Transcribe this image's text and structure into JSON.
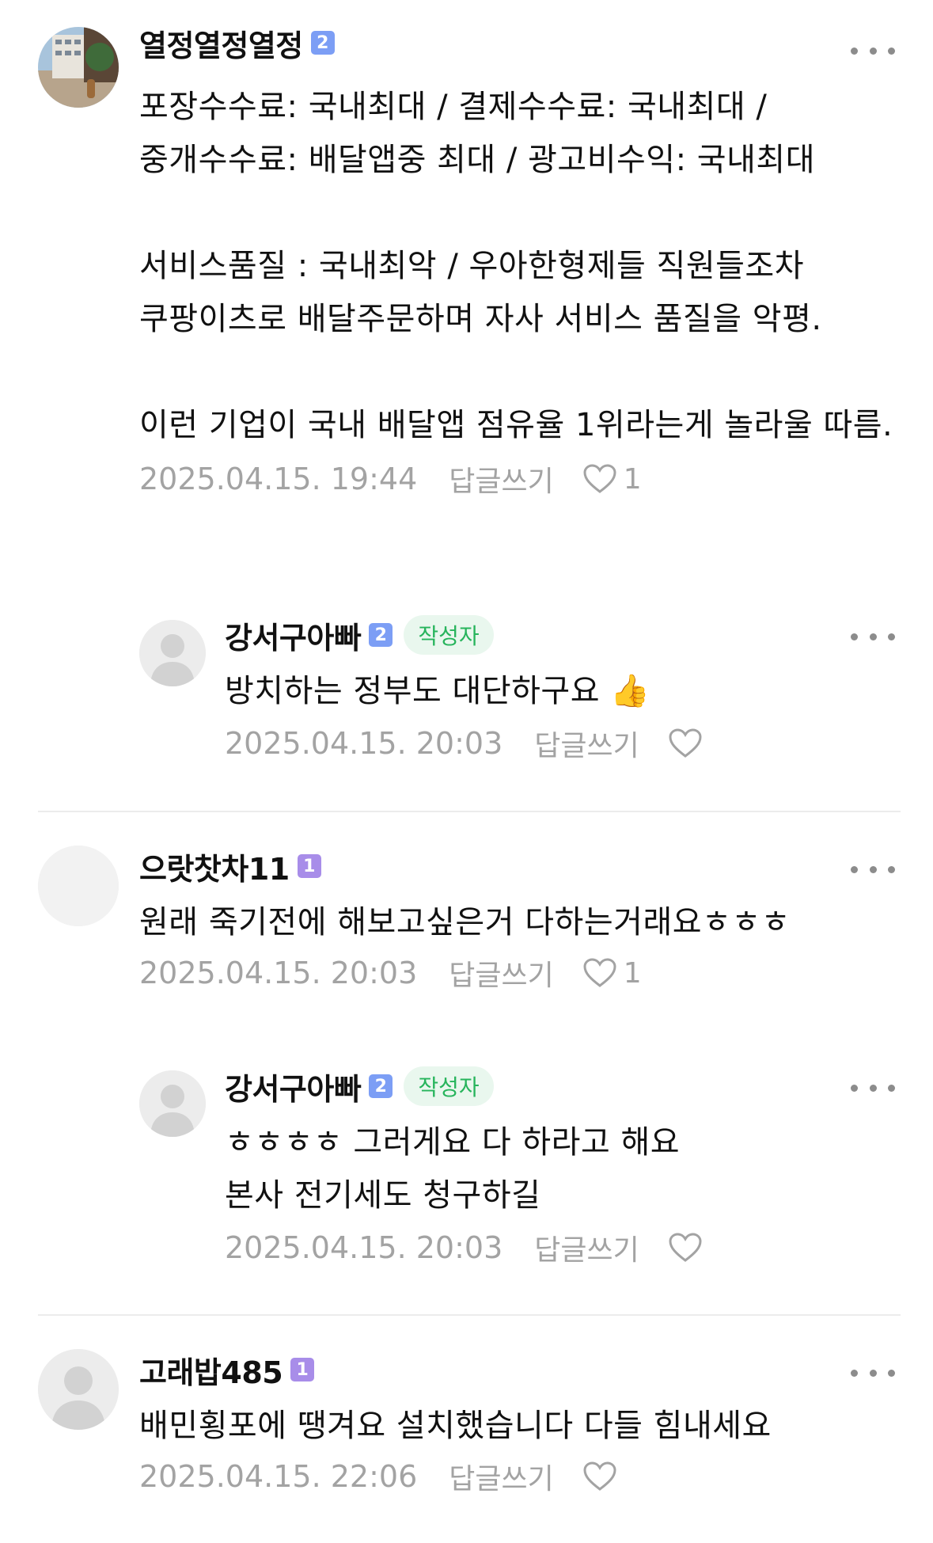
{
  "labels": {
    "reply": "답글쓰기",
    "author_badge": "작성자"
  },
  "colors": {
    "author_badge_bg": "#e9f7ee",
    "author_badge_text": "#27b45c",
    "level_2": "#7c9ef5",
    "level_1": "#a88de9",
    "meta_gray": "#a3a3a3"
  },
  "comments": [
    {
      "nickname": "열정열정열정",
      "level": "2",
      "text": "포장수수료: 국내최대 / 결제수수료: 국내최대 / 중개수수료: 배달앱중 최대 / 광고비수익: 국내최대\n\n서비스품질 : 국내최악 / 우아한형제들 직원들조차 쿠팡이츠로 배달주문하며 자사 서비스 품질을 악평.\n\n이런 기업이 국내 배달앱 점유율 1위라는게 놀라울 따름.",
      "date": "2025.04.15. 19:44",
      "likes": "1",
      "avatar_icon": "street-photo-avatar"
    },
    {
      "nickname": "강서구아빠",
      "level": "2",
      "is_author": true,
      "text": "방치하는 정부도 대단하구요 👍",
      "date": "2025.04.15. 20:03",
      "likes": "",
      "avatar_icon": "default-person-avatar"
    },
    {
      "nickname": "으랏찻차11",
      "level": "1",
      "text": "원래 죽기전에 해보고싶은거 다하는거래요ㅎㅎㅎ",
      "date": "2025.04.15. 20:03",
      "likes": "1",
      "avatar_icon": "blank-avatar"
    },
    {
      "nickname": "강서구아빠",
      "level": "2",
      "is_author": true,
      "text": "ㅎㅎㅎㅎ 그러게요 다 하라고 해요\n본사 전기세도 청구하길",
      "date": "2025.04.15. 20:03",
      "likes": "",
      "avatar_icon": "default-person-avatar"
    },
    {
      "nickname": "고래밥485",
      "level": "1",
      "text": "배민횡포에 땡겨요 설치했습니다 다들 힘내세요",
      "date": "2025.04.15. 22:06",
      "likes": "",
      "avatar_icon": "default-person-avatar"
    }
  ]
}
